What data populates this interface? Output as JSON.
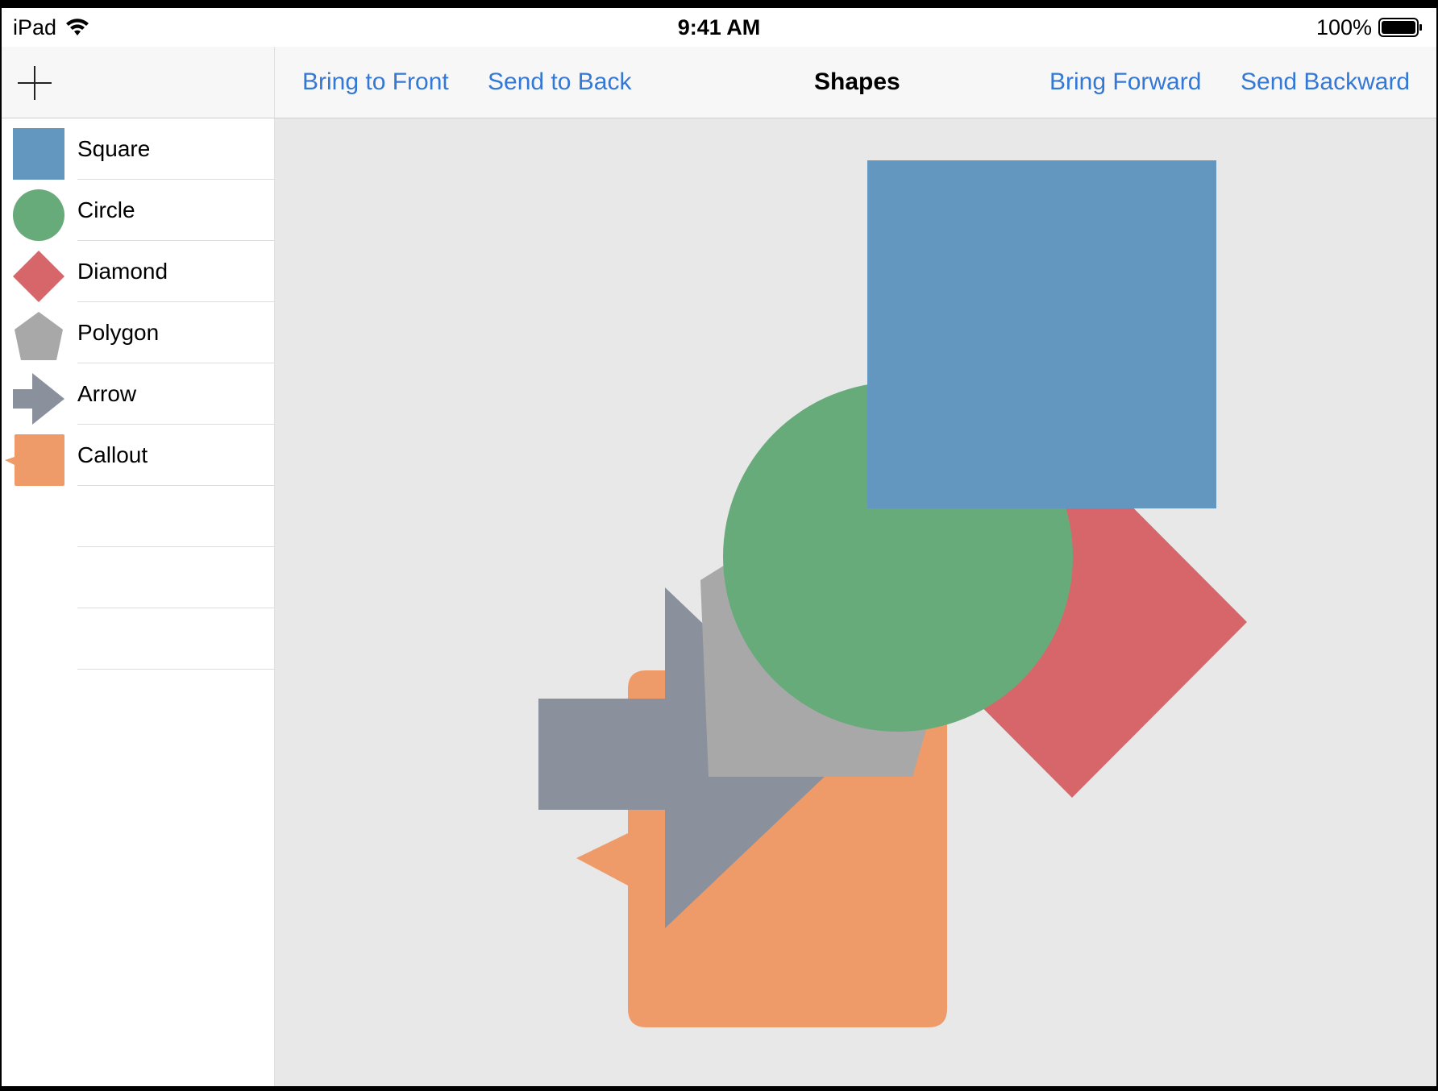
{
  "status_bar": {
    "device": "iPad",
    "time": "9:41 AM",
    "battery": "100%"
  },
  "toolbar": {
    "add_icon": "plus-icon",
    "bring_to_front": "Bring to Front",
    "send_to_back": "Send to Back",
    "title": "Shapes",
    "bring_forward": "Bring Forward",
    "send_backward": "Send Backward",
    "link_color": "#3478d6"
  },
  "sidebar": {
    "items": [
      {
        "label": "Square",
        "icon": "square-icon",
        "color": "#6497bf"
      },
      {
        "label": "Circle",
        "icon": "circle-icon",
        "color": "#68ab7a"
      },
      {
        "label": "Diamond",
        "icon": "diamond-icon",
        "color": "#d7666b"
      },
      {
        "label": "Polygon",
        "icon": "pentagon-icon",
        "color": "#a8a8a8"
      },
      {
        "label": "Arrow",
        "icon": "arrow-icon",
        "color": "#8a919c"
      },
      {
        "label": "Callout",
        "icon": "callout-icon",
        "color": "#ee9b69"
      }
    ]
  },
  "canvas": {
    "background": "#e8e8e8",
    "shapes_back_to_front": [
      "Callout",
      "Arrow",
      "Polygon",
      "Diamond",
      "Circle",
      "Square"
    ]
  }
}
